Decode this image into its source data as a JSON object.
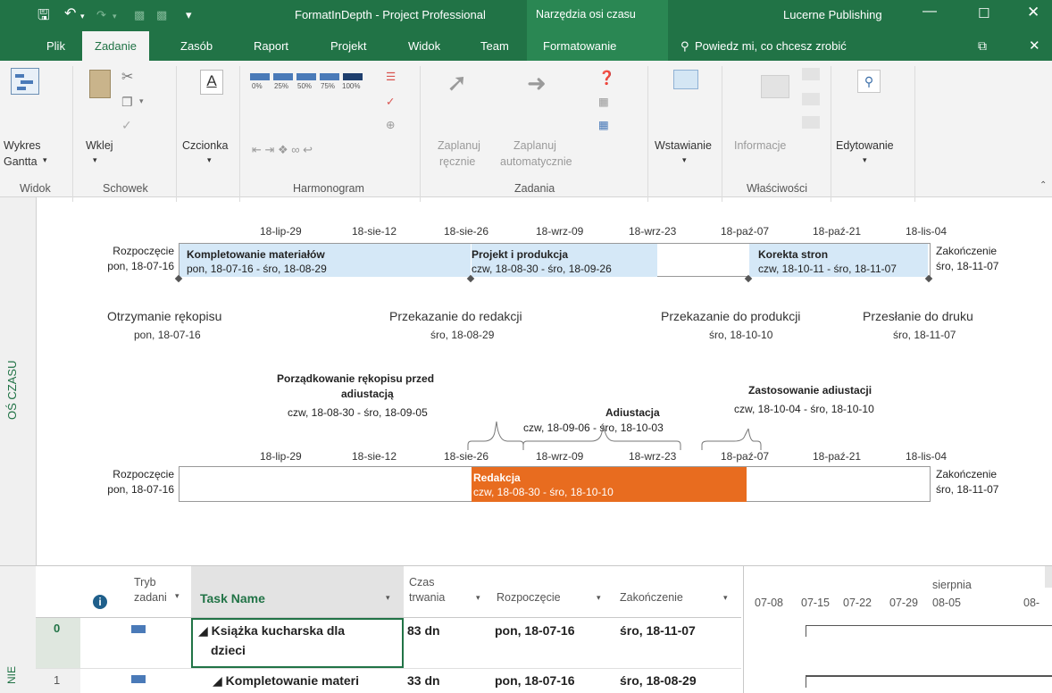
{
  "titlebar": {
    "document_title": "FormatInDepth - Project Professional",
    "context_tools": "Narzędzia osi czasu",
    "account": "Lucerne Publishing"
  },
  "tabs": [
    "Plik",
    "Zadanie",
    "Zasób",
    "Raport",
    "Projekt",
    "Widok",
    "Team",
    "Formatowanie"
  ],
  "tell_me": "Powiedz mi, co chcesz zrobić",
  "ribbon": {
    "gantt": [
      "Wykres",
      "Gantta"
    ],
    "paste": "Wklej",
    "font": "Czcionka",
    "pct": [
      "0%",
      "25%",
      "50%",
      "75%",
      "100%"
    ],
    "manual": [
      "Zaplanuj",
      "ręcznie"
    ],
    "auto": [
      "Zaplanuj",
      "automatycznie"
    ],
    "insert": "Wstawianie",
    "info": "Informacje",
    "edit": "Edytowanie",
    "groups": [
      "Widok",
      "Schowek",
      "Harmonogram",
      "Zadania",
      "Właściwości"
    ]
  },
  "side_label": "OŚ CZASU",
  "timeline": {
    "ticks": [
      "18-lip-29",
      "18-sie-12",
      "18-sie-26",
      "18-wrz-09",
      "18-wrz-23",
      "18-paź-07",
      "18-paź-21",
      "18-lis-04"
    ],
    "start_label": "Rozpoczęcie",
    "start_date": "pon, 18-07-16",
    "end_label": "Zakończenie",
    "end_date": "śro, 18-11-07",
    "bar1": [
      {
        "name": "Kompletowanie materiałów",
        "dates": "pon, 18-07-16 - śro, 18-08-29"
      },
      {
        "name": "Projekt i produkcja",
        "dates": "czw, 18-08-30 - śro, 18-09-26"
      },
      {
        "name": "Korekta stron",
        "dates": "czw, 18-10-11 - śro, 18-11-07"
      }
    ],
    "milestones": [
      {
        "name": "Otrzymanie rękopisu",
        "date": "pon, 18-07-16"
      },
      {
        "name": "Przekazanie do redakcji",
        "date": "śro, 18-08-29"
      },
      {
        "name": "Przekazanie do produkcji",
        "date": "śro, 18-10-10"
      },
      {
        "name": "Przesłanie do druku",
        "date": "śro, 18-11-07"
      }
    ],
    "callouts": [
      {
        "name1": "Porządkowanie rękopisu przed",
        "name2": "adiustacją",
        "dates": "czw, 18-08-30 - śro, 18-09-05"
      },
      {
        "name": "Adiustacja",
        "dates": "czw, 18-09-06 - śro, 18-10-03"
      },
      {
        "name": "Zastosowanie adiustacji",
        "dates": "czw, 18-10-04 - śro, 18-10-10"
      }
    ],
    "redakcja": {
      "name": "Redakcja",
      "dates": "czw, 18-08-30 - śro, 18-10-10"
    }
  },
  "grid": {
    "headers": {
      "mode1": "Tryb",
      "mode2": "zadani",
      "task": "Task Name",
      "dur1": "Czas",
      "dur2": "trwania",
      "start": "Rozpoczęcie",
      "finish": "Zakończenie",
      "month": "sierpnia",
      "weeks": [
        "07-08",
        "07-15",
        "07-22",
        "07-29",
        "08-05",
        "08-"
      ]
    },
    "rows": [
      {
        "id": "0",
        "name1": "Książka kucharska dla",
        "name2": "dzieci",
        "duration": "83 dn",
        "start": "pon, 18-07-16",
        "finish": "śro, 18-11-07"
      },
      {
        "id": "1",
        "name1": "Kompletowanie materi",
        "duration": "33 dn",
        "start": "pon, 18-07-16",
        "finish": "śro, 18-08-29"
      }
    ],
    "side_frag": "NIE"
  },
  "colors": {
    "brand": "#217346",
    "bar_blue": "#d5e8f7",
    "bar_orange": "#e86c1f"
  }
}
